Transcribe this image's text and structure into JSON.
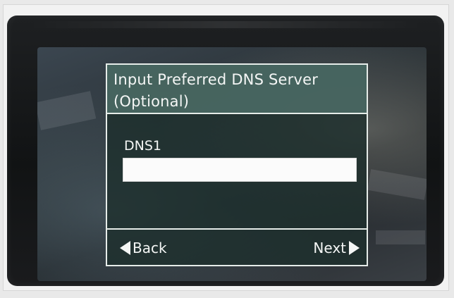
{
  "dialog": {
    "title": "Input Preferred DNS Server\n(Optional)",
    "field_label": "DNS1",
    "field_value": "",
    "back_label": "Back",
    "next_label": "Next"
  },
  "colors": {
    "dialog_header": "#4a6863",
    "dialog_border": "#e6ece9",
    "text": "#f4f6f5",
    "input_bg": "#fbfbfb",
    "device_bezel": "#111314"
  },
  "icons": {
    "back": "left-triangle-icon",
    "next": "right-triangle-icon"
  }
}
